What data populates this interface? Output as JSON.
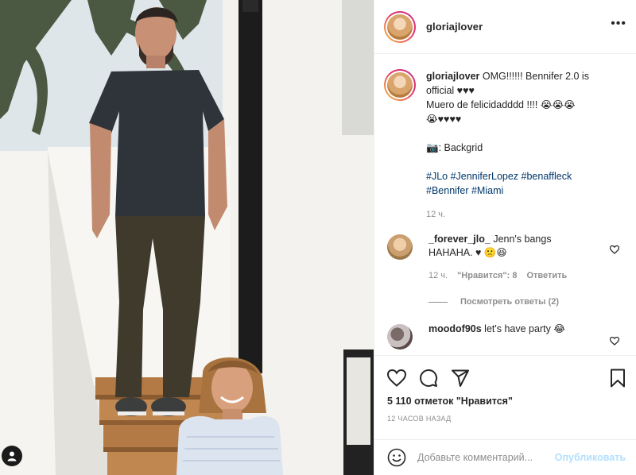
{
  "post": {
    "username": "gloriajlover",
    "more_label": "•••",
    "caption_lines": [
      "OMG!!!!!! Bennifer 2.0 is",
      "official ♥♥♥",
      "Muero de felicidadddd !!!! 😭😭😭",
      "😭♥♥♥♥"
    ],
    "credit": "📷: Backgrid",
    "hashtags_line1": "#JLo #JenniferLopez #benaffleck",
    "hashtags_line2": "#Bennifer #Miami",
    "caption_time": "12 ч."
  },
  "comments": [
    {
      "username": "_forever_jlo_",
      "text_line1": "Jenn's bangs",
      "text_line2": "HAHAHA. ♥ 🙁😆",
      "time": "12 ч.",
      "likes": "\"Нравится\": 8",
      "reply": "Ответить",
      "view_replies": "Посмотреть ответы (2)"
    },
    {
      "username": "moodof90s",
      "text": "let's have party 😂"
    }
  ],
  "likes_count": "5 110 отметок \"Нравится\"",
  "posted_ago": "12 ЧАСОВ НАЗАД",
  "add_comment": {
    "placeholder": "Добавьте комментарий...",
    "publish": "Опубликовать"
  },
  "icons": {
    "heart": "heart-icon",
    "comment": "comment-icon",
    "share": "share-icon",
    "bookmark": "bookmark-icon",
    "emoji": "emoji-icon",
    "tag": "user-tag-icon"
  },
  "colors": {
    "link": "#00376b",
    "muted": "#8e8e8e",
    "publish_disabled": "#b2dffc"
  }
}
